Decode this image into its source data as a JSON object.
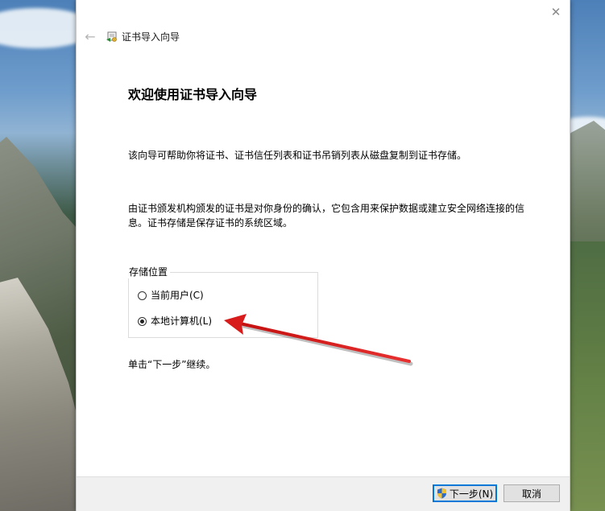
{
  "window": {
    "title": "证书导入向导",
    "close_glyph": "✕",
    "back_glyph": "←"
  },
  "content": {
    "heading": "欢迎使用证书导入向导",
    "intro": "该向导可帮助你将证书、证书信任列表和证书吊销列表从磁盘复制到证书存储。",
    "description": "由证书颁发机构颁发的证书是对你身份的确认，它包含用来保护数据或建立安全网络连接的信息。证书存储是保存证书的系统区域。",
    "store_location": {
      "legend": "存储位置",
      "options": [
        {
          "label": "当前用户(C)",
          "selected": false
        },
        {
          "label": "本地计算机(L)",
          "selected": true
        }
      ]
    },
    "footnote": "单击“下一步”继续。"
  },
  "buttons": {
    "next": "下一步(N)",
    "cancel": "取消"
  },
  "icons": {
    "title": "certificate-icon",
    "next": "uac-shield-icon"
  },
  "colors": {
    "accent": "#0078d7",
    "annotation_arrow": "#e02020"
  }
}
